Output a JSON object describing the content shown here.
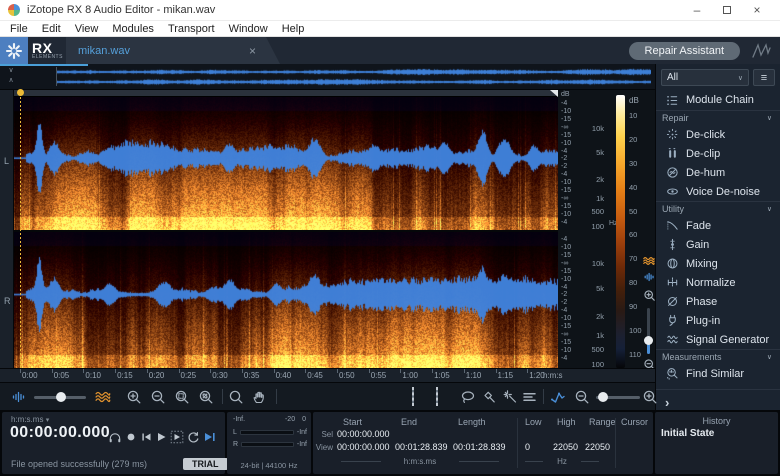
{
  "window": {
    "title": "iZotope RX 8 Audio Editor - mikan.wav"
  },
  "glyphs": {
    "minimize": "–",
    "close": "×",
    "chevron-down": "∨",
    "chevron-up": "∧",
    "caret-down": "▾",
    "hamburger": "≡",
    "expand-right": "›"
  },
  "menu": {
    "items": [
      "File",
      "Edit",
      "View",
      "Modules",
      "Transport",
      "Window",
      "Help"
    ]
  },
  "header": {
    "logo_main": "RX",
    "logo_sub": "ELEMENTS",
    "tab_title": "mikan.wav",
    "repair_assistant_label": "Repair Assistant"
  },
  "modules_panel": {
    "filter_value": "All",
    "module_chain_label": "Module Chain",
    "sections": [
      {
        "label": "Repair",
        "items": [
          {
            "label": "De-click",
            "icon": "de-click"
          },
          {
            "label": "De-clip",
            "icon": "de-clip"
          },
          {
            "label": "De-hum",
            "icon": "de-hum"
          },
          {
            "label": "Voice De-noise",
            "icon": "voice-de-noise"
          }
        ]
      },
      {
        "label": "Utility",
        "items": [
          {
            "label": "Fade",
            "icon": "fade"
          },
          {
            "label": "Gain",
            "icon": "gain"
          },
          {
            "label": "Mixing",
            "icon": "mixing"
          },
          {
            "label": "Normalize",
            "icon": "normalize"
          },
          {
            "label": "Phase",
            "icon": "phase"
          },
          {
            "label": "Plug-in",
            "icon": "plug-in"
          },
          {
            "label": "Signal Generator",
            "icon": "signal-generator"
          }
        ]
      },
      {
        "label": "Measurements",
        "items": [
          {
            "label": "Find Similar",
            "icon": "find-similar"
          }
        ]
      }
    ]
  },
  "editor": {
    "channel_labels": [
      "L",
      "R"
    ],
    "amp_unit": "dB",
    "amp_ticks": [
      "-4",
      "-10",
      "-15",
      "-∞",
      "-15",
      "-10",
      "-4",
      "-2",
      "-2",
      "-4",
      "-10",
      "-15",
      "-∞",
      "-15",
      "-10",
      "-4"
    ],
    "freq_ticks": [
      "10k",
      "5k",
      "2k",
      "1k",
      "500",
      "100"
    ],
    "freq_unit": "Hz",
    "colormap": {
      "unit": "dB",
      "ticks": [
        "10",
        "20",
        "30",
        "40",
        "50",
        "60",
        "70",
        "80",
        "90",
        "100",
        "110"
      ]
    },
    "ruler": {
      "ticks": [
        "0:00",
        "0:05",
        "0:10",
        "0:15",
        "0:20",
        "0:25",
        "0:30",
        "0:35",
        "0:40",
        "0:45",
        "0:50",
        "0:55",
        "1:00",
        "1:05",
        "1:10",
        "1:15",
        "1:20"
      ],
      "unit": "h:m:s"
    }
  },
  "transport": {
    "format_label": "h:m:s.ms",
    "time": "00:00:00.000",
    "status": "File opened successfully (279 ms)",
    "trial": "TRIAL"
  },
  "meters": {
    "scale_min": "-Inf.",
    "scale_mid": "-20",
    "scale_max": "0",
    "channels": [
      {
        "label": "L",
        "value": "-Inf"
      },
      {
        "label": "R",
        "value": "-Inf"
      }
    ],
    "format_info": "24-bit | 44100 Hz"
  },
  "selection_info": {
    "columns": [
      "Start",
      "End",
      "Length"
    ],
    "rows": [
      {
        "label": "Sel",
        "start": "00:00:00.000",
        "end": "",
        "length": ""
      },
      {
        "label": "View",
        "start": "00:00:00.000",
        "end": "00:01:28.839",
        "length": "00:01:28.839"
      }
    ],
    "time_unit": "h:m:s.ms",
    "freq_columns": [
      "Low",
      "High",
      "Range"
    ],
    "freq_values": [
      "0",
      "22050",
      "22050"
    ],
    "freq_unit": "Hz",
    "cursor_label": "Cursor"
  },
  "history": {
    "title": "History",
    "items": [
      "Initial State"
    ]
  }
}
